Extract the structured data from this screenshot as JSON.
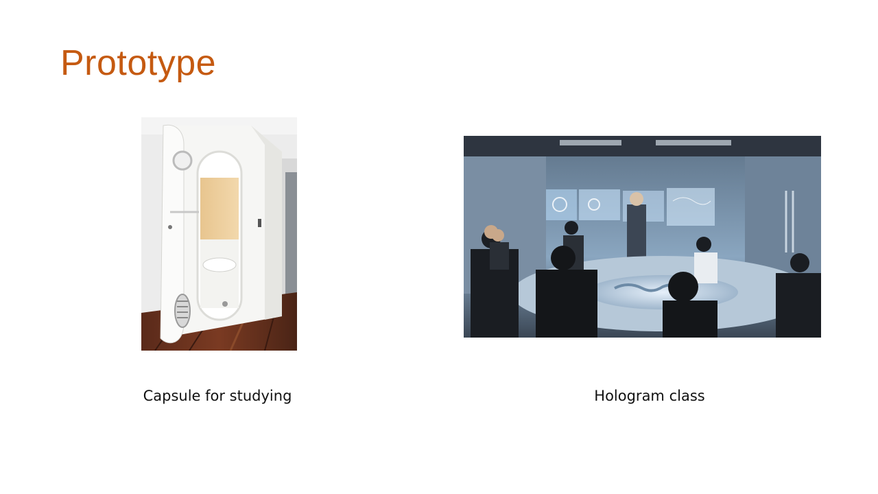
{
  "slide": {
    "title": "Prototype"
  },
  "items": [
    {
      "caption": "Capsule for studying",
      "image": "study-capsule-photo"
    },
    {
      "caption": "Hologram class",
      "image": "hologram-classroom-photo"
    }
  ],
  "colors": {
    "title": "#c55a11",
    "caption": "#111111",
    "background": "#ffffff"
  }
}
